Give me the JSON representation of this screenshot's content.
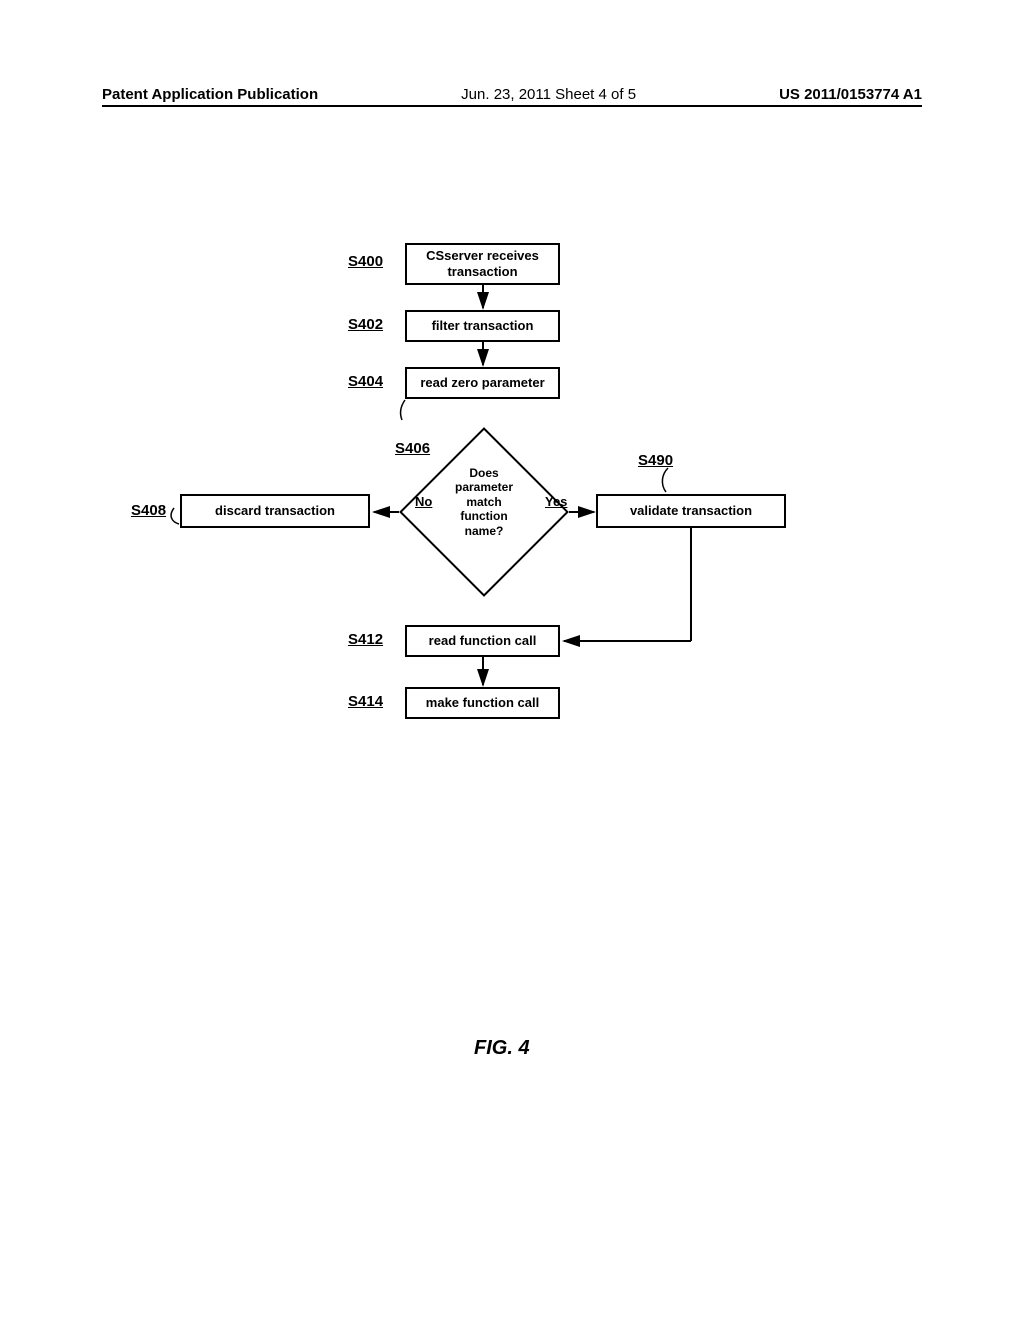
{
  "header": {
    "left": "Patent Application Publication",
    "center": "Jun. 23, 2011  Sheet 4 of 5",
    "right": "US 2011/0153774 A1"
  },
  "labels": {
    "s400": "S400",
    "s402": "S402",
    "s404": "S404",
    "s406": "S406",
    "s408": "S408",
    "s490": "S490",
    "s412": "S412",
    "s414": "S414"
  },
  "boxes": {
    "b400": "CSserver receives transaction",
    "b402": "filter transaction",
    "b404": "read zero parameter",
    "b406": "Does parameter match function name?",
    "b408": "discard transaction",
    "b490": "validate transaction",
    "b412": "read function call",
    "b414": "make function call"
  },
  "branches": {
    "no": "No",
    "yes": "Yes"
  },
  "figure_caption": "FIG. 4"
}
